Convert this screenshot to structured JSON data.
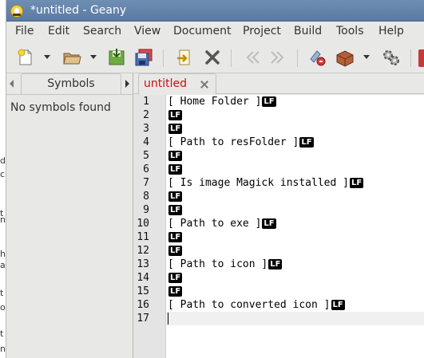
{
  "window": {
    "title": "*untitled - Geany"
  },
  "menu": [
    "File",
    "Edit",
    "Search",
    "View",
    "Document",
    "Project",
    "Build",
    "Tools",
    "Help"
  ],
  "toolbar": {
    "icons": [
      "new-file-icon",
      "open-file-icon",
      "save-icon",
      "save-all-icon",
      "revert-icon",
      "close-icon",
      "back-icon",
      "forward-icon",
      "compile-icon",
      "build-icon",
      "execute-icon"
    ]
  },
  "sidebar": {
    "tab_label": "Symbols",
    "empty_text": "No symbols found"
  },
  "editor": {
    "tab_label": "untitled",
    "eol_marker": "LF",
    "lines": [
      {
        "number": "1",
        "text": "[ Home Folder ]",
        "eol": true
      },
      {
        "number": "2",
        "text": "",
        "eol": true
      },
      {
        "number": "3",
        "text": "",
        "eol": true
      },
      {
        "number": "4",
        "text": "[ Path to resFolder ]",
        "eol": true
      },
      {
        "number": "5",
        "text": "",
        "eol": true
      },
      {
        "number": "6",
        "text": "",
        "eol": true
      },
      {
        "number": "7",
        "text": "[ Is image Magick installed ]",
        "eol": true
      },
      {
        "number": "8",
        "text": "",
        "eol": true
      },
      {
        "number": "9",
        "text": "",
        "eol": true
      },
      {
        "number": "10",
        "text": "[ Path to exe ]",
        "eol": true
      },
      {
        "number": "11",
        "text": "",
        "eol": true
      },
      {
        "number": "12",
        "text": "",
        "eol": true
      },
      {
        "number": "13",
        "text": "[ Path to icon ]",
        "eol": true
      },
      {
        "number": "14",
        "text": "",
        "eol": true
      },
      {
        "number": "15",
        "text": "",
        "eol": true
      },
      {
        "number": "16",
        "text": "[ Path to converted icon ]",
        "eol": true
      },
      {
        "number": "17",
        "text": "",
        "eol": false
      }
    ],
    "current_line": "17"
  },
  "background_window": {
    "fragments": [
      "d",
      "c",
      "t",
      "n",
      "ha",
      "a",
      "t",
      "o",
      "t",
      "n"
    ]
  },
  "colors": {
    "titlebar": "#5f7fa8",
    "modified_tab_label": "#cc1010",
    "editor_bg": "#ffffff",
    "current_line_bg": "#f0f0f0"
  }
}
